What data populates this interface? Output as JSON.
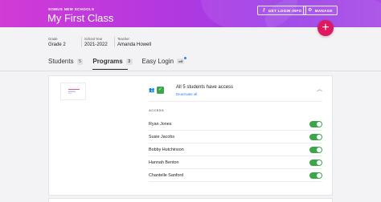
{
  "header": {
    "school_name": "SOMUS NEW SCHOOLS",
    "class_title": "My First Class",
    "login_info_button": "GET LOGIN INFO",
    "manage_button": "MANAGE",
    "add_button": "+"
  },
  "class_info": {
    "grade_label": "Grade",
    "grade_value": "Grade 2",
    "school_year_label": "School Year",
    "school_year_value": "2021-2022",
    "teacher_label": "Teacher",
    "teacher_value": "Amanda Howell"
  },
  "tabs": [
    {
      "label": "Students",
      "count": "5"
    },
    {
      "label": "Programs",
      "count": "3"
    },
    {
      "label": "Easy Login",
      "badge": "off"
    }
  ],
  "program": {
    "thumbnail_title": "Literacy",
    "thumbnail_subtitle": "Plus",
    "access_summary": "All 5 students have access",
    "deactivate_link": "Deactivate all",
    "access_section_label": "ACCESS",
    "students": [
      {
        "name": "Ryan Jones",
        "access": true
      },
      {
        "name": "Susie Jacobs",
        "access": true
      },
      {
        "name": "Bobby Hutchinson",
        "access": true
      },
      {
        "name": "Hannah Benton",
        "access": true
      },
      {
        "name": "Chantelle Sanford",
        "access": true
      }
    ]
  },
  "colors": {
    "header_gradient_start": "#d13bd6",
    "header_gradient_end": "#9a3ee8",
    "fab": "#e0185e",
    "toggle_on": "#3aa54a",
    "link": "#2d7ff9"
  },
  "icons": {
    "login_info": "key-icon",
    "manage": "gear-icon",
    "access": "people-icon",
    "collapse": "chevron-up-icon"
  }
}
